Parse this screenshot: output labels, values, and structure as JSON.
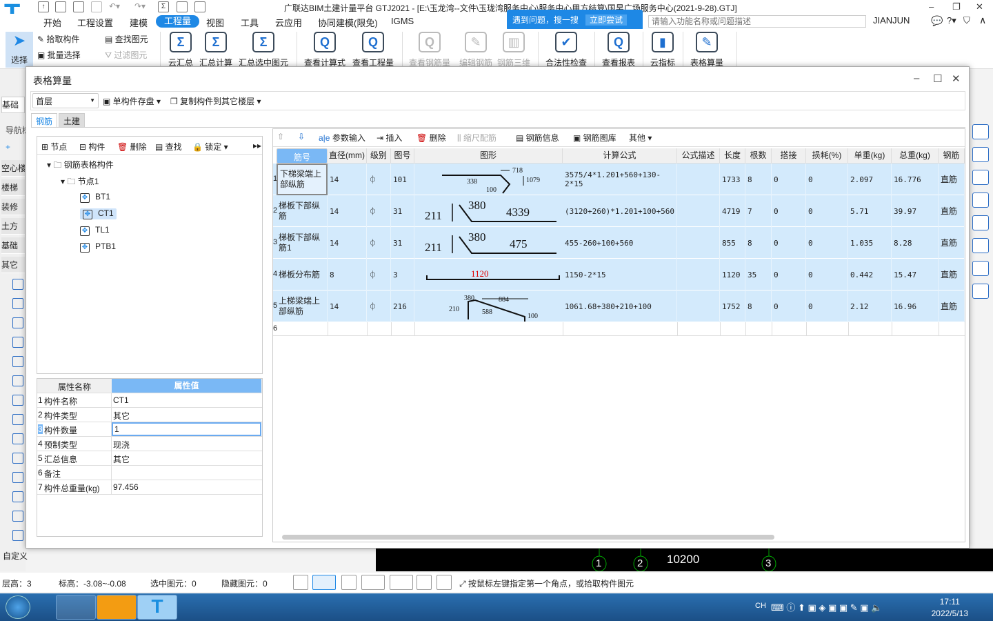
{
  "app": {
    "title": "广联达BIM土建计量平台 GTJ2021 - [E:\\玉龙湾--文件\\玉珑湾服务中心\\服务中心甲方结算\\国昊广场服务中心(2021-9-28).GTJ]",
    "user": "JIANJUN"
  },
  "menu": [
    "开始",
    "工程设置",
    "建模",
    "工程量",
    "视图",
    "工具",
    "云应用",
    "协同建模(限免)",
    "IGMS"
  ],
  "help": {
    "text": "遇到问题，搜一搜",
    "action": "立即尝试",
    "search_placeholder": "请输入功能名称或问题描述"
  },
  "ribbon": {
    "select": "选择",
    "pick": "拾取构件",
    "batch": "批量选择",
    "find": "查找图元",
    "filter": "过滤图元",
    "big": [
      {
        "label": "云汇总",
        "icon": "Σ",
        "enabled": true
      },
      {
        "label": "汇总计算",
        "icon": "Σ",
        "enabled": true
      },
      {
        "label": "汇总选中图元",
        "icon": "Σ",
        "enabled": true
      },
      {
        "label": "查看计算式",
        "icon": "Q",
        "enabled": true
      },
      {
        "label": "查看工程量",
        "icon": "Q",
        "enabled": true
      },
      {
        "label": "查看钢筋量",
        "icon": "Q",
        "enabled": false
      },
      {
        "label": "编辑钢筋",
        "icon": "✎",
        "enabled": false
      },
      {
        "label": "钢筋三维",
        "icon": "▥",
        "enabled": false
      },
      {
        "label": "合法性检查",
        "icon": "✔",
        "enabled": true
      },
      {
        "label": "查看报表",
        "icon": "Q",
        "enabled": true
      },
      {
        "label": "云指标",
        "icon": "▮",
        "enabled": true
      },
      {
        "label": "表格算量",
        "icon": "✎",
        "enabled": true
      }
    ]
  },
  "left": {
    "floor": "基础层",
    "nav": "导航树",
    "items": [
      "空心楼盖",
      "楼梯",
      "装修",
      "土方",
      "基础",
      "其它"
    ],
    "custom": "自定义"
  },
  "dialog": {
    "title": "表格算量",
    "floor": "首层",
    "save": "单构件存盘",
    "copy": "复制构件到其它楼层",
    "tabs": [
      "钢筋",
      "土建"
    ],
    "tree_toolbar": [
      "节点",
      "构件",
      "删除",
      "查找",
      "锁定"
    ],
    "tree": {
      "root": "钢筋表格构件",
      "node": "节点1",
      "items": [
        "BT1",
        "CT1",
        "TL1",
        "PTB1"
      ],
      "selected": "CT1"
    },
    "props": {
      "headers": [
        "属性名称",
        "属性值"
      ],
      "rows": [
        [
          "构件名称",
          "CT1"
        ],
        [
          "构件类型",
          "其它"
        ],
        [
          "构件数量",
          "1"
        ],
        [
          "预制类型",
          "现浇"
        ],
        [
          "汇总信息",
          "其它"
        ],
        [
          "备注",
          ""
        ],
        [
          "构件总重量(kg)",
          "97.456"
        ]
      ]
    },
    "grid_toolbar": [
      "参数输入",
      "插入",
      "删除",
      "缩尺配筋",
      "钢筋信息",
      "钢筋图库",
      "其他"
    ],
    "columns": [
      "筋号",
      "直径(mm)",
      "级别",
      "图号",
      "图形",
      "计算公式",
      "公式描述",
      "长度",
      "根数",
      "搭接",
      "损耗(%)",
      "单重(kg)",
      "总重(kg)",
      "钢筋"
    ],
    "rows": [
      {
        "no": "1",
        "name": "下梯梁端上部纵筋",
        "dia": "14",
        "grade": "⏀",
        "fig": "101",
        "shape": [
          "338",
          "100",
          "718",
          "1079"
        ],
        "formula": "3575/4*1.201+560+130-2*15",
        "desc": "",
        "len": "1733",
        "count": "8",
        "lap": "0",
        "loss": "0",
        "unit": "2.097",
        "total": "16.776",
        "type": "直筋"
      },
      {
        "no": "2",
        "name": "梯板下部纵筋",
        "dia": "14",
        "grade": "⏀",
        "fig": "31",
        "shape": [
          "211",
          "380",
          "4339"
        ],
        "formula": "(3120+260)*1.201+100+560",
        "desc": "",
        "len": "4719",
        "count": "7",
        "lap": "0",
        "loss": "0",
        "unit": "5.71",
        "total": "39.97",
        "type": "直筋"
      },
      {
        "no": "3",
        "name": "梯板下部纵筋1",
        "dia": "14",
        "grade": "⏀",
        "fig": "31",
        "shape": [
          "211",
          "380",
          "475"
        ],
        "formula": "455-260+100+560",
        "desc": "",
        "len": "855",
        "count": "8",
        "lap": "0",
        "loss": "0",
        "unit": "1.035",
        "total": "8.28",
        "type": "直筋"
      },
      {
        "no": "4",
        "name": "梯板分布筋",
        "dia": "8",
        "grade": "⏀",
        "fig": "3",
        "shape": [
          "1120"
        ],
        "formula": "1150-2*15",
        "desc": "",
        "len": "1120",
        "count": "35",
        "lap": "0",
        "loss": "0",
        "unit": "0.442",
        "total": "15.47",
        "type": "直筋"
      },
      {
        "no": "5",
        "name": "上梯梁端上部纵筋",
        "dia": "14",
        "grade": "⏀",
        "fig": "216",
        "shape": [
          "380",
          "884",
          "210",
          "588",
          "100"
        ],
        "formula": "1061.68+380+210+100",
        "desc": "",
        "len": "1752",
        "count": "8",
        "lap": "0",
        "loss": "0",
        "unit": "2.12",
        "total": "16.96",
        "type": "直筋"
      }
    ],
    "empty_row": "6"
  },
  "canvas": {
    "axes": [
      "1",
      "2",
      "3"
    ],
    "dim": "10200"
  },
  "status": {
    "floor_h": "层高：3",
    "elev": "标高：-3.08~-0.08",
    "selected": "选中图元：0",
    "hidden": "隐藏图元：0",
    "hint": "按鼠标左键指定第一个角点，或拾取构件图元"
  },
  "taskbar": {
    "lang": "CH",
    "time": "17:11",
    "date": "2022/5/13"
  },
  "colors": {
    "accent": "#1e88e5",
    "row_bg": "#d3eafc",
    "header_sel": "#7ab8f5",
    "red_label": "#e00000"
  }
}
